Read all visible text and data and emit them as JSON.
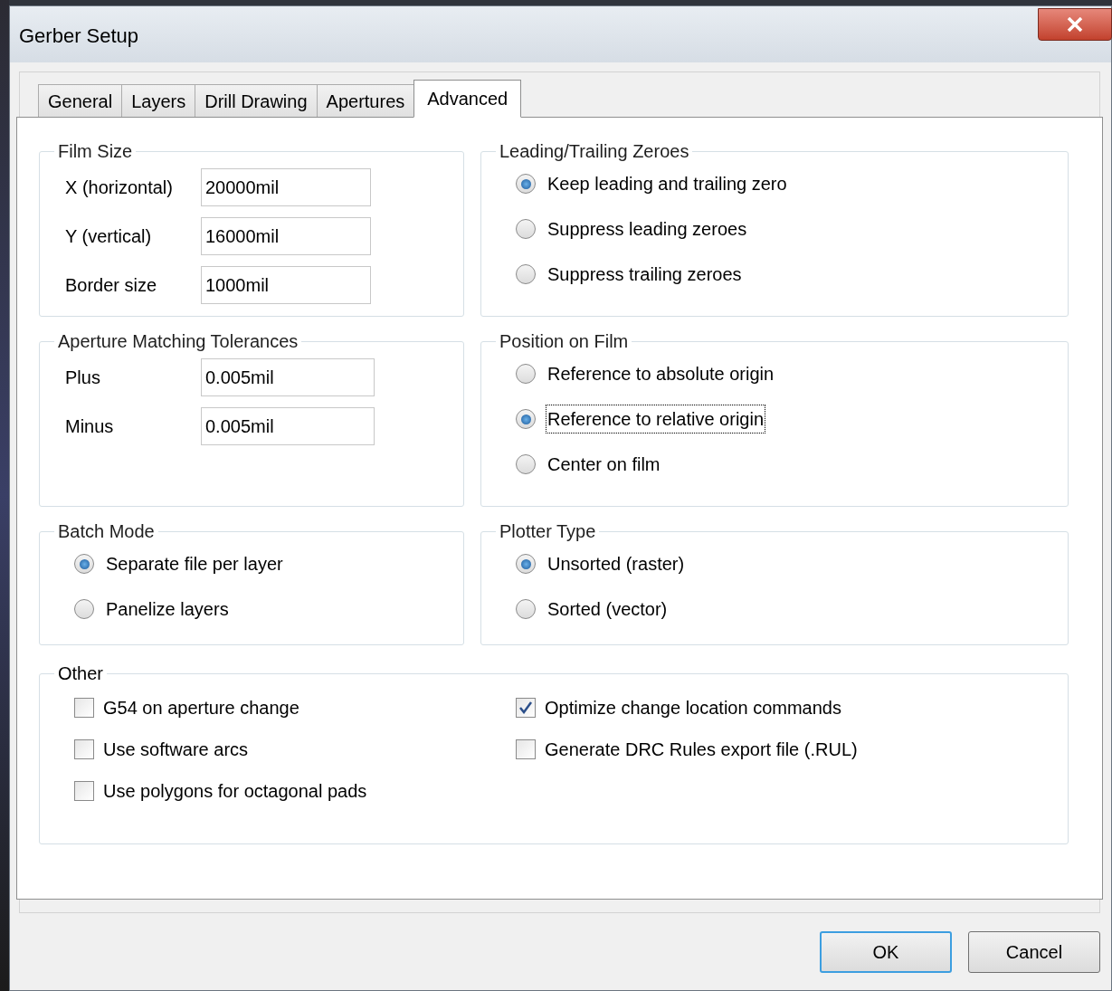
{
  "window": {
    "title": "Gerber Setup"
  },
  "tabs": [
    {
      "label": "General",
      "selected": false
    },
    {
      "label": "Layers",
      "selected": false
    },
    {
      "label": "Drill Drawing",
      "selected": false
    },
    {
      "label": "Apertures",
      "selected": false
    },
    {
      "label": "Advanced",
      "selected": true
    }
  ],
  "groups": [
    {
      "kind": "fields",
      "title": "Film Size",
      "fields": [
        {
          "label": "X (horizontal)",
          "value": "20000mil"
        },
        {
          "label": "Y (vertical)",
          "value": "16000mil"
        },
        {
          "label": "Border size",
          "value": "1000mil"
        }
      ]
    },
    {
      "kind": "radios",
      "title": "Leading/Trailing Zeroes",
      "options": [
        {
          "label": "Keep leading and trailing zero",
          "selected": true,
          "focused": false
        },
        {
          "label": "Suppress leading zeroes",
          "selected": false,
          "focused": false
        },
        {
          "label": "Suppress trailing zeroes",
          "selected": false,
          "focused": false
        }
      ]
    },
    {
      "kind": "fields",
      "title": "Aperture Matching Tolerances",
      "fields": [
        {
          "label": "Plus",
          "value": "0.005mil"
        },
        {
          "label": "Minus",
          "value": "0.005mil"
        }
      ]
    },
    {
      "kind": "radios",
      "title": "Position on Film",
      "options": [
        {
          "label": "Reference to absolute origin",
          "selected": false,
          "focused": false
        },
        {
          "label": "Reference to relative origin",
          "selected": true,
          "focused": true
        },
        {
          "label": "Center on film",
          "selected": false,
          "focused": false
        }
      ]
    },
    {
      "kind": "radios",
      "title": "Batch Mode",
      "options": [
        {
          "label": "Separate file per layer",
          "selected": true,
          "focused": false
        },
        {
          "label": "Panelize layers",
          "selected": false,
          "focused": false
        }
      ]
    },
    {
      "kind": "radios",
      "title": "Plotter Type",
      "options": [
        {
          "label": "Unsorted (raster)",
          "selected": true,
          "focused": false
        },
        {
          "label": "Sorted (vector)",
          "selected": false,
          "focused": false
        }
      ]
    }
  ],
  "other": {
    "title": "Other",
    "columns": [
      [
        {
          "label": "G54 on aperture change",
          "checked": false
        },
        {
          "label": "Use software arcs",
          "checked": false
        },
        {
          "label": "Use polygons for octagonal pads",
          "checked": false
        }
      ],
      [
        {
          "label": "Optimize change location commands",
          "checked": true
        },
        {
          "label": "Generate DRC Rules export file (.RUL)",
          "checked": false
        }
      ]
    ]
  },
  "buttons": [
    {
      "label": "OK",
      "default": true
    },
    {
      "label": "Cancel",
      "default": false
    }
  ]
}
